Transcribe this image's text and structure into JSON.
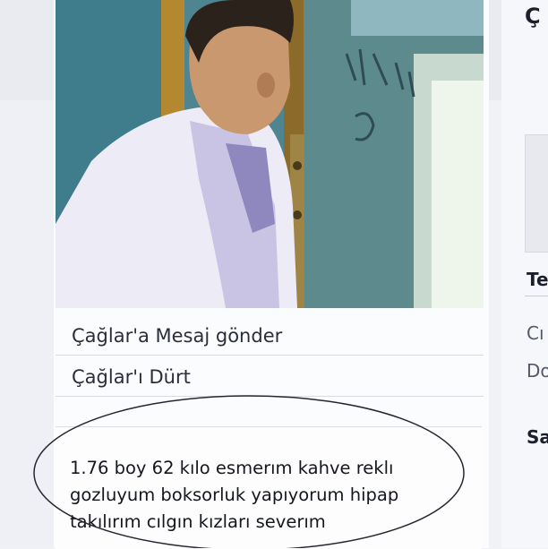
{
  "actions": {
    "message": "Çağlar'a Mesaj gönder",
    "poke": "Çağlar'ı Dürt"
  },
  "bio": {
    "line1": "1.76 boy 62 kılo esmerım kahve reklı",
    "line2": "gozluyum boksorluk yapıyorum hipap",
    "line3": "takılırım cılgın kızları severım"
  },
  "right_column": {
    "name_fragment": "Ç",
    "section1_title": "Te",
    "row1": "Cı",
    "row2": "Do",
    "section2_title": "Sa"
  }
}
